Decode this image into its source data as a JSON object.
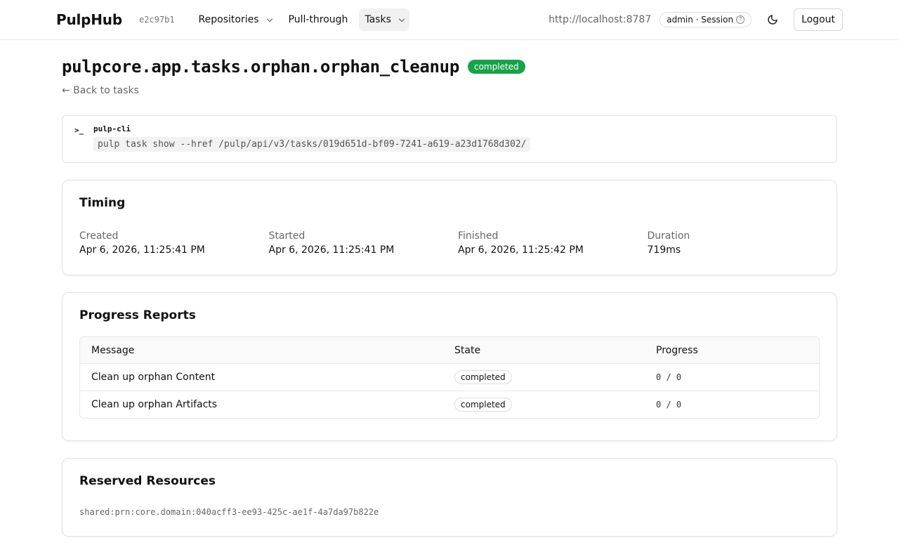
{
  "header": {
    "brand": "PulpHub",
    "commit": "e2c97b1",
    "nav": [
      {
        "label": "Repositories",
        "has_dropdown": true,
        "active": false
      },
      {
        "label": "Pull-through",
        "has_dropdown": false,
        "active": false
      },
      {
        "label": "Tasks",
        "has_dropdown": true,
        "active": true
      }
    ],
    "server_url": "http://localhost:8787",
    "session_label": "admin · Session",
    "help_icon": "?",
    "theme_icon": "moon-icon",
    "logout_label": "Logout"
  },
  "task": {
    "title": "pulpcore.app.tasks.orphan.orphan_cleanup",
    "status": "completed",
    "status_color": "#16a34a",
    "back_label": "← Back to tasks"
  },
  "cli": {
    "prompt": ">_",
    "label": "pulp-cli",
    "command": "pulp task show --href /pulp/api/v3/tasks/019d651d-bf09-7241-a619-a23d1768d302/"
  },
  "timing": {
    "title": "Timing",
    "items": [
      {
        "label": "Created",
        "value": "Apr 6, 2026, 11:25:41 PM"
      },
      {
        "label": "Started",
        "value": "Apr 6, 2026, 11:25:41 PM"
      },
      {
        "label": "Finished",
        "value": "Apr 6, 2026, 11:25:42 PM"
      },
      {
        "label": "Duration",
        "value": "719ms"
      }
    ]
  },
  "progress": {
    "title": "Progress Reports",
    "columns": [
      "Message",
      "State",
      "Progress"
    ],
    "rows": [
      {
        "message": "Clean up orphan Content",
        "state": "completed",
        "progress": "0 / 0"
      },
      {
        "message": "Clean up orphan Artifacts",
        "state": "completed",
        "progress": "0 / 0"
      }
    ]
  },
  "reserved": {
    "title": "Reserved Resources",
    "resources": [
      "shared:prn:core.domain:040acff3-ee93-425c-ae1f-4a7da97b822e"
    ]
  }
}
